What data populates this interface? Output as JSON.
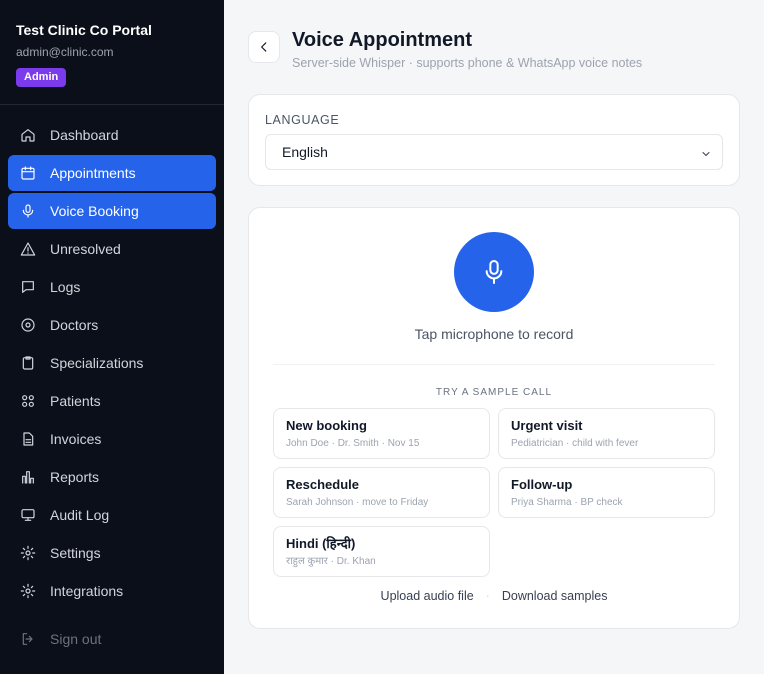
{
  "sidebar": {
    "brand_title": "Test Clinic Co Portal",
    "email": "admin@clinic.com",
    "badge": "Admin",
    "items": [
      {
        "label": "Dashboard",
        "icon": "home-icon"
      },
      {
        "label": "Appointments",
        "icon": "calendar-icon",
        "active": true
      },
      {
        "label": "Voice Booking",
        "icon": "mic-icon",
        "active": true
      },
      {
        "label": "Unresolved",
        "icon": "warning-icon"
      },
      {
        "label": "Logs",
        "icon": "chat-icon"
      },
      {
        "label": "Doctors",
        "icon": "stethoscope-icon"
      },
      {
        "label": "Specializations",
        "icon": "clipboard-icon"
      },
      {
        "label": "Patients",
        "icon": "users-icon"
      },
      {
        "label": "Invoices",
        "icon": "file-icon"
      },
      {
        "label": "Reports",
        "icon": "bar-chart-icon"
      },
      {
        "label": "Audit Log",
        "icon": "monitor-icon"
      },
      {
        "label": "Settings",
        "icon": "gear-icon"
      },
      {
        "label": "Integrations",
        "icon": "gear-icon"
      }
    ],
    "signout": "Sign out"
  },
  "header": {
    "title": "Voice Appointment",
    "subtitle": "Server-side Whisper · supports phone & WhatsApp voice notes"
  },
  "language": {
    "label": "LANGUAGE",
    "selected": "English"
  },
  "recorder": {
    "prompt": "Tap microphone to record",
    "try_label": "TRY A SAMPLE CALL",
    "samples": [
      {
        "title": "New booking",
        "sub": "John Doe · Dr. Smith · Nov 15"
      },
      {
        "title": "Urgent visit",
        "sub": "Pediatrician · child with fever"
      },
      {
        "title": "Reschedule",
        "sub": "Sarah Johnson · move to Friday"
      },
      {
        "title": "Follow-up",
        "sub": "Priya Sharma · BP check"
      },
      {
        "title": "Hindi (हिन्दी)",
        "sub": "राहुल कुमार · Dr. Khan"
      }
    ],
    "upload": "Upload audio file",
    "separator": "·",
    "download": "Download samples"
  },
  "colors": {
    "accent": "#2563eb",
    "sidebar_bg": "#0b0f19",
    "badge": "#7c3aed"
  }
}
